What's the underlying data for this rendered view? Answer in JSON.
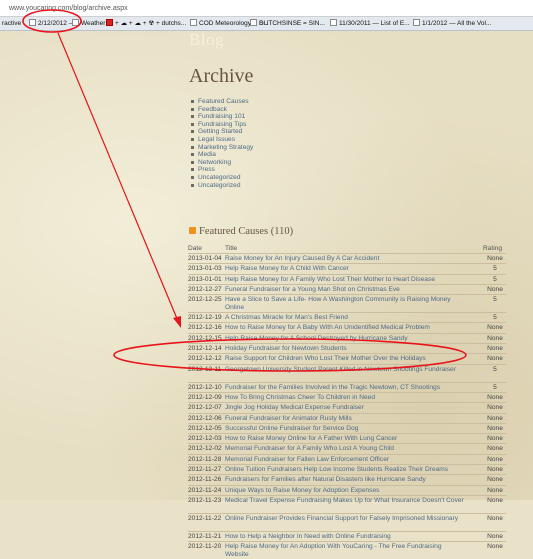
{
  "browser": {
    "url": "www.youcaring.com/blog/archive.aspx",
    "bookmarks": [
      {
        "label": "ractive",
        "icon": "none"
      },
      {
        "label": "2/12/2012 —",
        "icon": "page-icon"
      },
      {
        "label": "Weather ...",
        "icon": "weather-icon"
      },
      {
        "label": "+ ☁ + ☁ + ☢ + dutchs...",
        "icon": "youtube-icon"
      },
      {
        "label": "COD Meteorology -- S...",
        "icon": "page-icon"
      },
      {
        "label": "DUTCHSINSE = SIN...",
        "icon": "page-icon"
      },
      {
        "label": "11/30/2011 — List of E...",
        "icon": "page-icon"
      },
      {
        "label": "1/1/2012 — All the Vol...",
        "icon": "page-icon"
      }
    ]
  },
  "header": {
    "blog_title": "Blog"
  },
  "archive": {
    "title": "Archive",
    "categories": [
      "Featured Causes",
      "Feedback",
      "Fundraising 101",
      "Fundraising Tips",
      "Getting Started",
      "Legal Issues",
      "Marketing Strategy",
      "Media",
      "Networking",
      "Press",
      "Uncategorized",
      "Uncategorized"
    ]
  },
  "featured": {
    "heading": "Featured Causes (110)",
    "columns": {
      "date": "Date",
      "title": "Title",
      "rating": "Rating"
    },
    "rows": [
      {
        "date": "2013-01-04",
        "title": "Raise Money for An Injury Caused By A Car Accident",
        "rating": "None"
      },
      {
        "date": "2013-01-03",
        "title": "Help Raise Money for A Child With Cancer",
        "rating": "5"
      },
      {
        "date": "2013-01-01",
        "title": "Help Raise Money for A Family Who Lost Their Mother to Heart Disease",
        "rating": "5"
      },
      {
        "date": "2012-12-27",
        "title": "Funeral Fundraiser for a Young Man Shot on Christmas Eve",
        "rating": "None"
      },
      {
        "date": "2012-12-25",
        "title": "Have a Slice to Save a Life- How A Washington Community is Raising Money Online",
        "rating": "5"
      },
      {
        "date": "2012-12-19",
        "title": "A Christmas Miracle for Man's Best Friend",
        "rating": "5"
      },
      {
        "date": "2012-12-16",
        "title": "How to Raise Money for A Baby With An Unidentified Medical Problem",
        "rating": "None"
      },
      {
        "date": "2012-12-15",
        "title": "Help Raise Money for A School Destroyed by Hurricane Sandy",
        "rating": "None"
      },
      {
        "date": "2012-12-14",
        "title": "Holiday Fundraiser for Newtown Students",
        "rating": "None"
      },
      {
        "date": "2012-12-12",
        "title": "Raise Support for Children Who Lost Their Mother Over the Holidays",
        "rating": "None"
      },
      {
        "date": "2012-12-11",
        "title": "Georgetown University Student Parent Killed in Newtown Shootings Fundraiser",
        "rating": "5"
      },
      {
        "date": "2012-12-10",
        "title": "Fundraiser for the Families Involved in the Tragic Newtown, CT Shootings",
        "rating": "5"
      },
      {
        "date": "2012-12-09",
        "title": "How To Bring Christmas Cheer To Children in Need",
        "rating": "None"
      },
      {
        "date": "2012-12-07",
        "title": "Jingle Jog Holiday Medical Expense Fundraiser",
        "rating": "None"
      },
      {
        "date": "2012-12-06",
        "title": "Funeral Fundraiser for Animator Rusty Mills",
        "rating": "None"
      },
      {
        "date": "2012-12-05",
        "title": "Successful Online Fundraiser for Service Dog",
        "rating": "None"
      },
      {
        "date": "2012-12-03",
        "title": "How to Raise Money Online for A Father With Lung Cancer",
        "rating": "None"
      },
      {
        "date": "2012-12-02",
        "title": "Memorial Fundraiser for A Family Who Lost A Young Child",
        "rating": "None"
      },
      {
        "date": "2012-11-28",
        "title": "Memorial Fundraiser for Fallen Law Enforcement Officer",
        "rating": "None"
      },
      {
        "date": "2012-11-27",
        "title": "Online Tuition Fundraisers Help Low Income Students Realize Their Dreams",
        "rating": "None"
      },
      {
        "date": "2012-11-26",
        "title": "Fundraisers for Families after Natural Disasters like Hurricane Sandy",
        "rating": "None"
      },
      {
        "date": "2012-11-24",
        "title": "Unique Ways to Raise Money for Adoption Expenses",
        "rating": "None"
      },
      {
        "date": "2012-11-23",
        "title": "Medical Travel Expense Fundraising Makes Up for What Insurance Doesn't Cover",
        "rating": "None"
      },
      {
        "date": "2012-11-22",
        "title": "Online Fundraiser Provides Financial Support for Falsely Imprisoned Missionary",
        "rating": "None"
      },
      {
        "date": "2012-11-21",
        "title": "How to Help a Neighbor In Need with Online Fundraising",
        "rating": "None"
      },
      {
        "date": "2012-11-20",
        "title": "Help Raise Money for An Adoption With YouCaring - The Free Fundraising Website",
        "rating": "None"
      }
    ]
  },
  "annotation": {
    "color": "#e8141b"
  }
}
